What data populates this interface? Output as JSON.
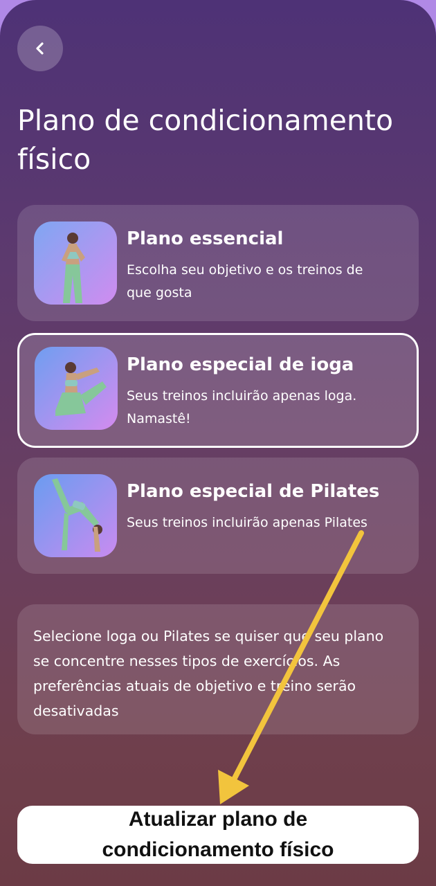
{
  "header": {
    "back_icon": "chevron-left-icon",
    "title": "Plano de condicionamento físico"
  },
  "plans": [
    {
      "title": "Plano essencial",
      "description": "Escolha seu objetivo e os treinos de que gosta",
      "selected": false
    },
    {
      "title": "Plano especial de ioga",
      "description": "Seus treinos incluirão apenas loga. Namastê!",
      "selected": true
    },
    {
      "title": "Plano especial de Pilates",
      "description": "Seus treinos incluirão apenas Pilates",
      "selected": false
    }
  ],
  "info_text": "Selecione loga ou Pilates se quiser que seu plano se concentre nesses tipos de exercícios. As preferências atuais de objetivo e treino serão desativadas",
  "update_button": {
    "label": "Atualizar plano de condicionamento físico"
  },
  "colors": {
    "annotation_arrow": "#f2c43d",
    "selected_border": "#ffffff"
  }
}
